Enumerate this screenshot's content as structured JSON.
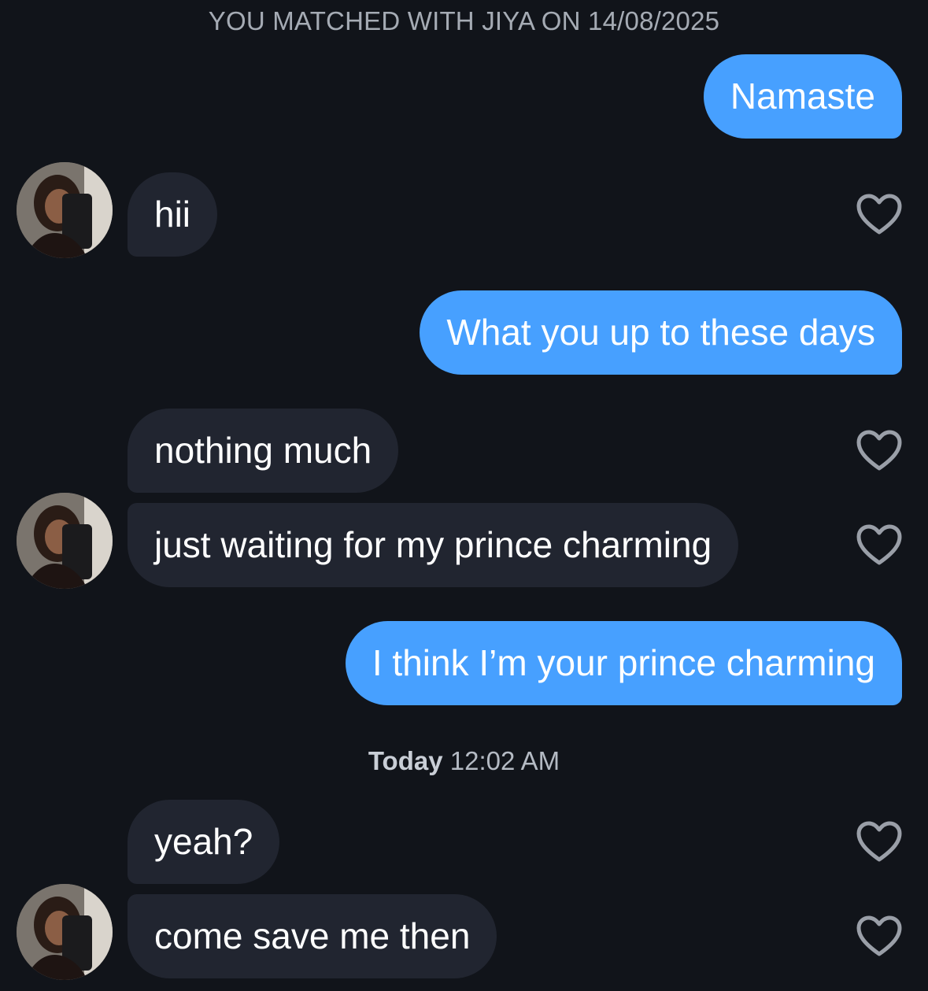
{
  "banner": "YOU MATCHED WITH JIYA ON 14/08/2025",
  "messages": [
    {
      "from": "me",
      "text": "Namaste"
    },
    {
      "from": "them",
      "text": "hii"
    },
    {
      "from": "me",
      "text": "What you up to these days"
    },
    {
      "from": "them",
      "text": "nothing much"
    },
    {
      "from": "them",
      "text": "just waiting for my prince charming"
    },
    {
      "from": "me",
      "text": "I think I’m your prince charming"
    },
    {
      "from": "them",
      "text": "yeah?"
    },
    {
      "from": "them",
      "text": "come save me then"
    }
  ],
  "timestamp": {
    "day": "Today",
    "time": "12:02 AM"
  },
  "colors": {
    "background": "#11141a",
    "outgoing": "#47a0ff",
    "incoming": "#212530"
  },
  "icons": {
    "like": "heart-outline-icon",
    "avatar": "profile-photo"
  }
}
